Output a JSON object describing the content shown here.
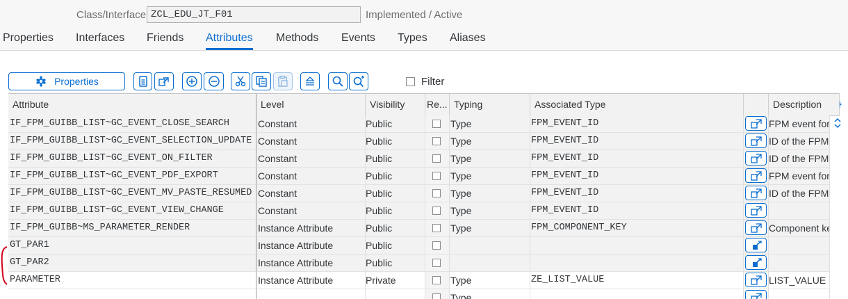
{
  "header": {
    "class_interface_label": "Class/Interface:",
    "class_interface_value": "ZCL_EDU_JT_F01",
    "status": "Implemented / Active"
  },
  "tabs": [
    {
      "label": "Properties"
    },
    {
      "label": "Interfaces"
    },
    {
      "label": "Friends"
    },
    {
      "label": "Attributes",
      "active": true
    },
    {
      "label": "Methods"
    },
    {
      "label": "Events"
    },
    {
      "label": "Types"
    },
    {
      "label": "Aliases"
    }
  ],
  "toolbar": {
    "properties_label": "Properties",
    "filter_label": "Filter",
    "icons": [
      "properties-icon",
      "detail-view-icon",
      "navigate-icon",
      "insert-row-icon",
      "delete-row-icon",
      "cut-icon",
      "copy-icon",
      "paste-icon",
      "sort-icon",
      "search-icon",
      "search-next-icon"
    ]
  },
  "columns": {
    "attribute": "Attribute",
    "level": "Level",
    "visibility": "Visibility",
    "read_only": "Re...",
    "typing": "Typing",
    "associated_type": "Associated Type",
    "description": "Description"
  },
  "rows": [
    {
      "attribute": "IF_FPM_GUIBB_LIST~GC_EVENT_CLOSE_SEARCH",
      "level": "Constant",
      "visibility": "Public",
      "typing": "Type",
      "associated_type": "FPM_EVENT_ID",
      "description": "FPM event for",
      "nav_icon": "navigate-arrow-icon"
    },
    {
      "attribute": "IF_FPM_GUIBB_LIST~GC_EVENT_SELECTION_UPDATE",
      "level": "Constant",
      "visibility": "Public",
      "typing": "Type",
      "associated_type": "FPM_EVENT_ID",
      "description": "ID of the FPM",
      "nav_icon": "navigate-arrow-icon"
    },
    {
      "attribute": "IF_FPM_GUIBB_LIST~GC_EVENT_ON_FILTER",
      "level": "Constant",
      "visibility": "Public",
      "typing": "Type",
      "associated_type": "FPM_EVENT_ID",
      "description": "ID of the FPM",
      "nav_icon": "navigate-arrow-icon"
    },
    {
      "attribute": "IF_FPM_GUIBB_LIST~GC_EVENT_PDF_EXPORT",
      "level": "Constant",
      "visibility": "Public",
      "typing": "Type",
      "associated_type": "FPM_EVENT_ID",
      "description": "FPM event for",
      "nav_icon": "navigate-arrow-icon"
    },
    {
      "attribute": "IF_FPM_GUIBB_LIST~GC_EVENT_MV_PASTE_RESUMED",
      "level": "Constant",
      "visibility": "Public",
      "typing": "Type",
      "associated_type": "FPM_EVENT_ID",
      "description": "ID of the FPM",
      "nav_icon": "navigate-arrow-icon"
    },
    {
      "attribute": "IF_FPM_GUIBB_LIST~GC_EVENT_VIEW_CHANGE",
      "level": "Constant",
      "visibility": "Public",
      "typing": "Type",
      "associated_type": "FPM_EVENT_ID",
      "description": "",
      "nav_icon": "navigate-arrow-icon"
    },
    {
      "attribute": "IF_FPM_GUIBB~MS_PARAMETER_RENDER",
      "level": "Instance Attribute",
      "visibility": "Public",
      "typing": "Type",
      "associated_type": "FPM_COMPONENT_KEY",
      "description": "Component ke",
      "nav_icon": "navigate-arrow-icon"
    },
    {
      "attribute": "GT_PAR1",
      "level": "Instance Attribute",
      "visibility": "Public",
      "typing": "",
      "associated_type": "",
      "description": "",
      "nav_icon": "edit-type-icon"
    },
    {
      "attribute": "GT_PAR2",
      "level": "Instance Attribute",
      "visibility": "Public",
      "typing": "",
      "associated_type": "",
      "description": "",
      "nav_icon": "edit-type-icon"
    },
    {
      "attribute": "PARAMETER",
      "level": "Instance Attribute",
      "visibility": "Private",
      "typing": "Type",
      "associated_type": "ZE_LIST_VALUE",
      "description": "LIST_VALUE",
      "nav_icon": "navigate-arrow-icon"
    },
    {
      "attribute": "",
      "level": "",
      "visibility": "",
      "typing": "Type",
      "associated_type": "",
      "description": "",
      "nav_icon": "navigate-arrow-icon"
    }
  ],
  "colors": {
    "accent": "#0a6ed1",
    "annotation": "#d0021b"
  }
}
